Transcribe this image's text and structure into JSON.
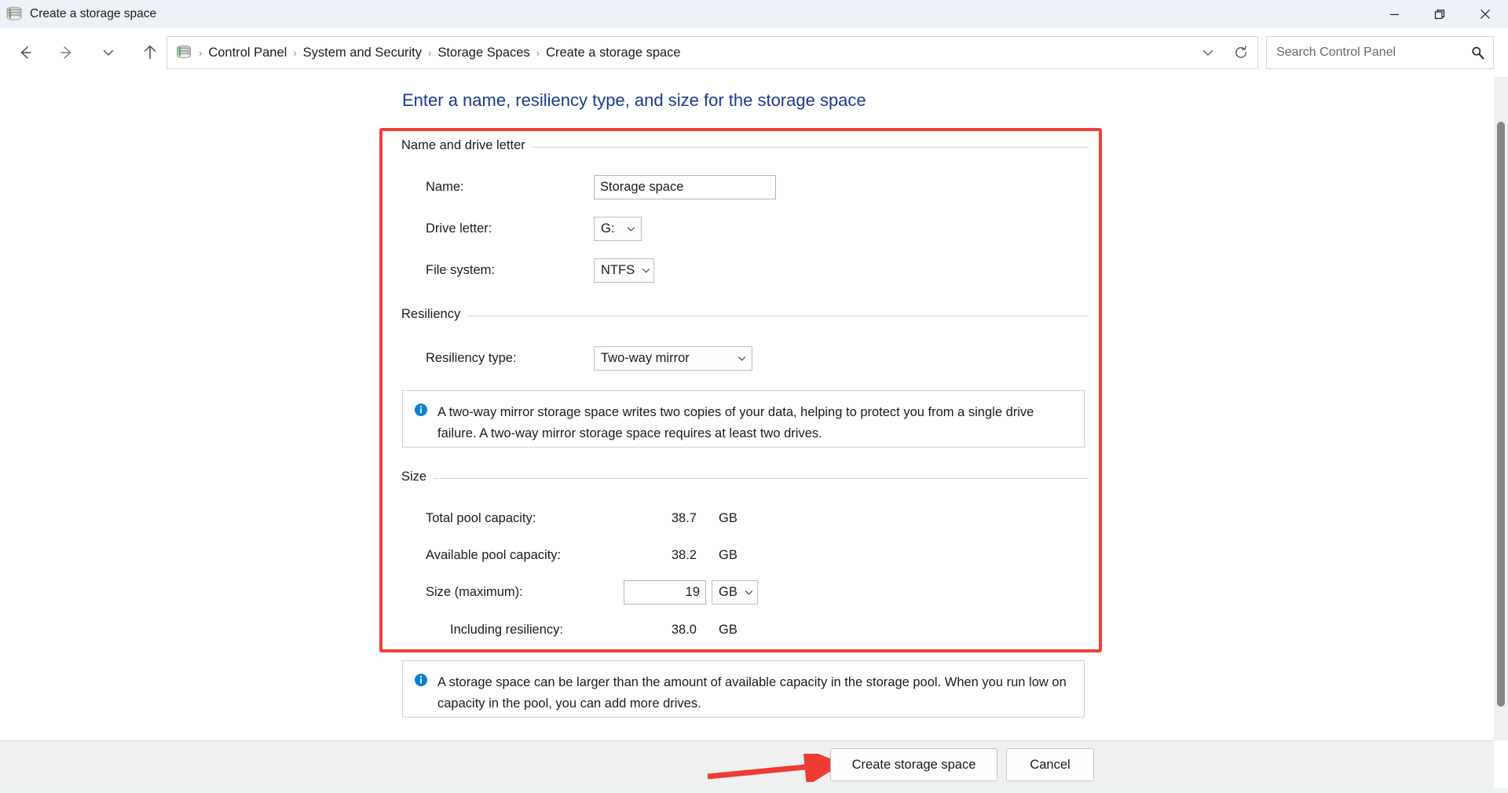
{
  "window": {
    "title": "Create a storage space",
    "icon": "storage-spaces-icon",
    "minimize_label": "Minimize",
    "maximize_label": "Restore",
    "close_label": "Close"
  },
  "nav": {
    "back_label": "Back",
    "forward_label": "Forward",
    "recent_label": "Recent locations",
    "up_label": "Up",
    "history_label": "Previous locations",
    "refresh_label": "Refresh"
  },
  "breadcrumb": {
    "items": [
      "Control Panel",
      "System and Security",
      "Storage Spaces",
      "Create a storage space"
    ],
    "separator": "›"
  },
  "search": {
    "placeholder": "Search Control Panel",
    "value": "",
    "icon": "search-icon"
  },
  "page": {
    "heading": "Enter a name, resiliency type, and size for the storage space"
  },
  "name_group": {
    "legend": "Name and drive letter",
    "name_label": "Name:",
    "name_value": "Storage space",
    "drive_letter_label": "Drive letter:",
    "drive_letter_value": "G:",
    "file_system_label": "File system:",
    "file_system_value": "NTFS"
  },
  "resiliency_group": {
    "legend": "Resiliency",
    "type_label": "Resiliency type:",
    "type_value": "Two-way mirror",
    "info": "A two-way mirror storage space writes two copies of your data, helping to protect you from a single drive failure. A two-way mirror storage space requires at least two drives."
  },
  "size_group": {
    "legend": "Size",
    "rows": [
      {
        "label": "Total pool capacity:",
        "value": "38.7",
        "unit": "GB"
      },
      {
        "label": "Available pool capacity:",
        "value": "38.2",
        "unit": "GB"
      },
      {
        "label": "Including resiliency:",
        "value": "38.0",
        "unit": "GB"
      }
    ],
    "size_max_label": "Size (maximum):",
    "size_max_value": "19",
    "size_max_unit": "GB",
    "info": "A storage space can be larger than the amount of available capacity in the storage pool. When you run low on capacity in the pool, you can add more drives."
  },
  "footer": {
    "create_label": "Create storage space",
    "cancel_label": "Cancel"
  },
  "annotations": {
    "highlight_color": "#ef4136",
    "arrow_color": "#ee3b33"
  },
  "colors": {
    "heading_blue": "#1a3a8f",
    "titlebar_bg": "#eef2f8",
    "info_icon_blue": "#0a7fd4"
  }
}
